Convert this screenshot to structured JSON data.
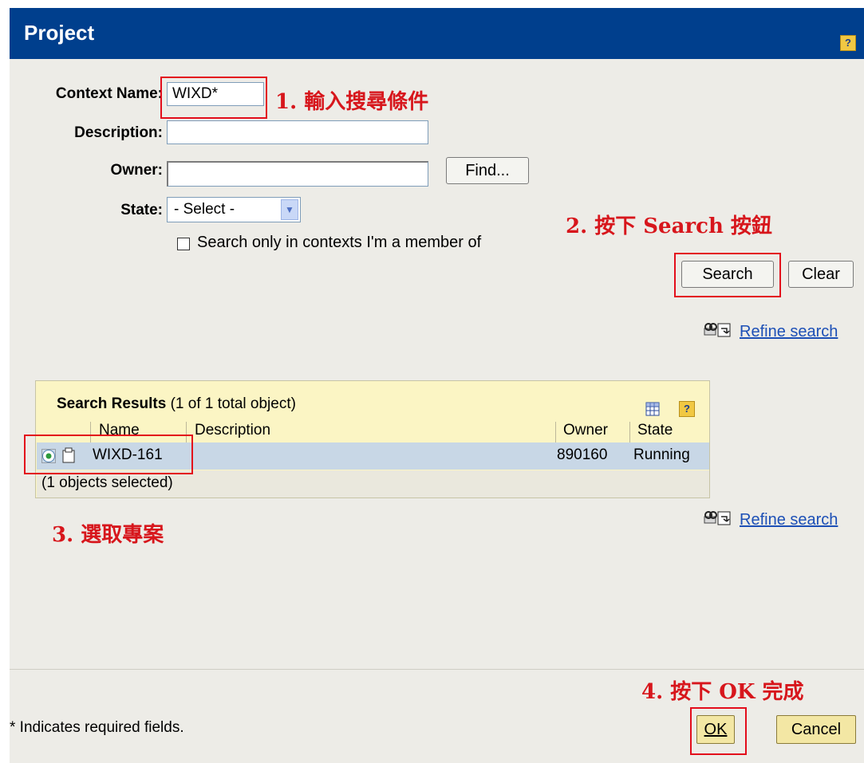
{
  "window": {
    "title": "Project",
    "help_label": "?"
  },
  "form": {
    "context_name_label": "Context Name:",
    "context_name_value": "WIXD*",
    "description_label": "Description:",
    "description_value": "",
    "owner_label": "Owner:",
    "owner_value": "",
    "find_label": "Find...",
    "state_label": "State:",
    "state_selected": "- Select -",
    "member_only_label": "Search only in contexts I'm a member of",
    "member_only_checked": false,
    "search_label": "Search",
    "clear_label": "Clear",
    "refine_label": "Refine search"
  },
  "annotations": {
    "step1": "1. 輸入搜尋條件",
    "step2": "2. 按下 Search 按鈕",
    "step3": "3. 選取專案",
    "step4": "4. 按下 OK 完成"
  },
  "results": {
    "title": "Search Results",
    "count_text": "(1 of 1 total object)",
    "help_label": "?",
    "columns": [
      "Name",
      "Description",
      "Owner",
      "State"
    ],
    "rows": [
      {
        "name": "WIXD-161",
        "description": "",
        "owner": "890160",
        "state": "Running",
        "selected": true
      }
    ],
    "selected_text": "(1 objects selected)",
    "refine_label": "Refine search"
  },
  "footer": {
    "required_note": "* Indicates required fields.",
    "ok_label": "OK",
    "cancel_label": "Cancel"
  },
  "colors": {
    "titlebar": "#003f8d",
    "annotation": "#d7161c",
    "results_bg": "#fbf5c4",
    "row_selected": "#c8d7e6"
  }
}
